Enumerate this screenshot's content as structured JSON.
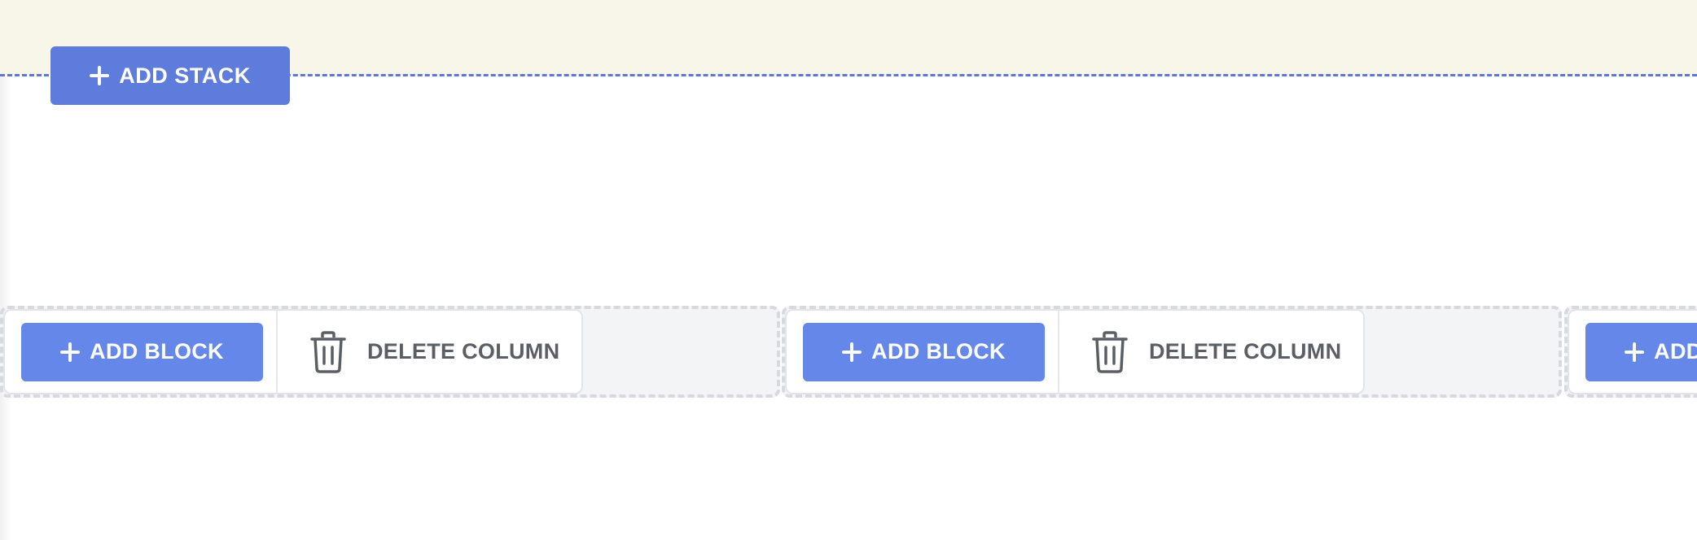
{
  "stack": {
    "add_stack_label": "ADD STACK",
    "add_stack_icon": "plus-icon"
  },
  "columns": [
    {
      "add_block_label": "ADD BLOCK",
      "delete_column_label": "DELETE COLUMN"
    },
    {
      "add_block_label": "ADD BLOCK",
      "delete_column_label": "DELETE COLUMN"
    },
    {
      "add_block_label": "ADD BLOCK"
    }
  ],
  "icons": {
    "add": "plus-icon",
    "delete": "trash-icon"
  },
  "colors": {
    "top_band": "#f8f5e9",
    "primary_button": "#6687ea",
    "add_stack_button": "#5d7cdc",
    "divider": "#5b78d4",
    "delete_text": "#5a5f66"
  }
}
